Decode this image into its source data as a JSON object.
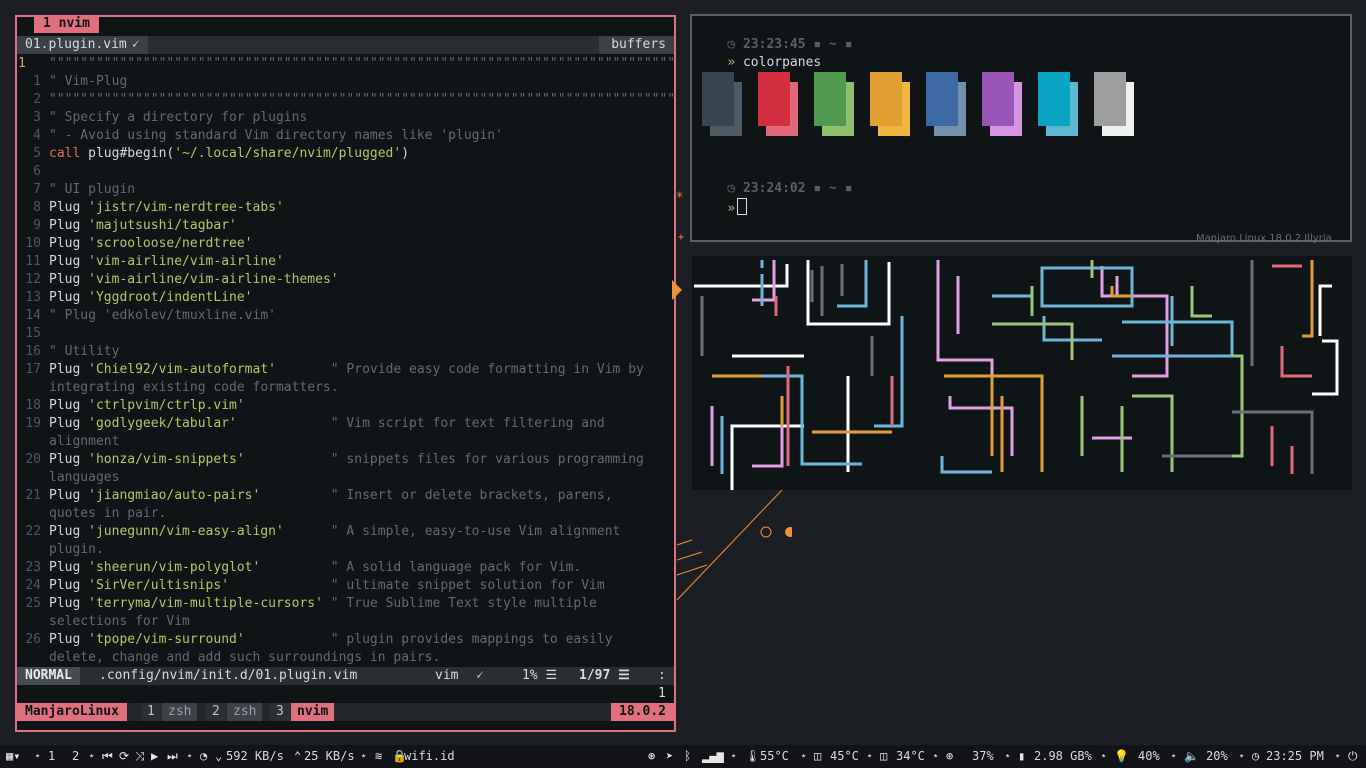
{
  "nvim": {
    "tab_title": "1 nvim",
    "file_tab": "01.plugin.vim",
    "file_icon": "🗸",
    "buffers_label": "buffers",
    "lines": [
      {
        "n": "1",
        "cur": true,
        "parts": [
          [
            "cmt",
            "\"\"\"\"\"\"\"\"\"\"\"\"\"\"\"\"\"\"\"\"\"\"\"\"\"\"\"\"\"\"\"\"\"\"\"\"\"\"\"\"\"\"\"\"\"\"\"\"\"\"\"\"\"\"\"\"\"\"\"\"\"\"\"\"\"\"\"\"\"\"\"\"\"\"\"\"\"\"\"\""
          ]
        ]
      },
      {
        "n": "1",
        "parts": [
          [
            "cmt",
            "\" Vim-Plug"
          ]
        ]
      },
      {
        "n": "2",
        "parts": [
          [
            "cmt",
            "\"\"\"\"\"\"\"\"\"\"\"\"\"\"\"\"\"\"\"\"\"\"\"\"\"\"\"\"\"\"\"\"\"\"\"\"\"\"\"\"\"\"\"\"\"\"\"\"\"\"\"\"\"\"\"\"\"\"\"\"\"\"\"\"\"\"\"\"\"\"\"\"\"\"\"\"\"\"\"\""
          ]
        ]
      },
      {
        "n": "3",
        "parts": [
          [
            "cmt",
            "\" Specify a directory for plugins"
          ]
        ]
      },
      {
        "n": "4",
        "parts": [
          [
            "cmt",
            "\" - Avoid using standard Vim directory names like 'plugin'"
          ]
        ]
      },
      {
        "n": "5",
        "parts": [
          [
            "kw",
            "call"
          ],
          [
            "plain",
            " plug#begin("
          ],
          [
            "str",
            "'~/.local/share/nvim/plugged'"
          ],
          [
            "plain",
            ")"
          ]
        ]
      },
      {
        "n": "6",
        "parts": []
      },
      {
        "n": "7",
        "parts": [
          [
            "cmt",
            "\" UI plugin"
          ]
        ]
      },
      {
        "n": "8",
        "parts": [
          [
            "plain",
            "Plug "
          ],
          [
            "str",
            "'jistr/vim-nerdtree-tabs'"
          ]
        ]
      },
      {
        "n": "9",
        "parts": [
          [
            "plain",
            "Plug "
          ],
          [
            "str",
            "'majutsushi/tagbar'"
          ]
        ]
      },
      {
        "n": "10",
        "parts": [
          [
            "plain",
            "Plug "
          ],
          [
            "str",
            "'scrooloose/nerdtree'"
          ]
        ]
      },
      {
        "n": "11",
        "parts": [
          [
            "plain",
            "Plug "
          ],
          [
            "str",
            "'vim-airline/vim-airline'"
          ]
        ]
      },
      {
        "n": "12",
        "parts": [
          [
            "plain",
            "Plug "
          ],
          [
            "str",
            "'vim-airline/vim-airline-themes'"
          ]
        ]
      },
      {
        "n": "13",
        "parts": [
          [
            "plain",
            "Plug "
          ],
          [
            "str",
            "'Yggdroot/indentLine'"
          ]
        ]
      },
      {
        "n": "14",
        "parts": [
          [
            "cmt",
            "\" Plug 'edkolev/tmuxline.vim'"
          ]
        ]
      },
      {
        "n": "15",
        "parts": []
      },
      {
        "n": "16",
        "parts": [
          [
            "cmt",
            "\" Utility"
          ]
        ]
      },
      {
        "n": "17",
        "parts": [
          [
            "plain",
            "Plug "
          ],
          [
            "str",
            "'Chiel92/vim-autoformat'"
          ],
          [
            "plain",
            "       "
          ],
          [
            "cmt",
            "\" Provide easy code formatting in Vim by"
          ]
        ]
      },
      {
        "n": "",
        "parts": [
          [
            "cmt",
            "integrating existing code formatters."
          ]
        ]
      },
      {
        "n": "18",
        "parts": [
          [
            "plain",
            "Plug "
          ],
          [
            "str",
            "'ctrlpvim/ctrlp.vim'"
          ]
        ]
      },
      {
        "n": "19",
        "parts": [
          [
            "plain",
            "Plug "
          ],
          [
            "str",
            "'godlygeek/tabular'"
          ],
          [
            "plain",
            "            "
          ],
          [
            "cmt",
            "\" Vim script for text filtering and"
          ]
        ]
      },
      {
        "n": "",
        "parts": [
          [
            "cmt",
            "alignment"
          ]
        ]
      },
      {
        "n": "20",
        "parts": [
          [
            "plain",
            "Plug "
          ],
          [
            "str",
            "'honza/vim-snippets'"
          ],
          [
            "plain",
            "           "
          ],
          [
            "cmt",
            "\" snippets files for various programming"
          ]
        ]
      },
      {
        "n": "",
        "parts": [
          [
            "cmt",
            "languages"
          ]
        ]
      },
      {
        "n": "21",
        "parts": [
          [
            "plain",
            "Plug "
          ],
          [
            "str",
            "'jiangmiao/auto-pairs'"
          ],
          [
            "plain",
            "         "
          ],
          [
            "cmt",
            "\" Insert or delete brackets, parens,"
          ]
        ]
      },
      {
        "n": "",
        "parts": [
          [
            "cmt",
            "quotes in pair."
          ]
        ]
      },
      {
        "n": "22",
        "parts": [
          [
            "plain",
            "Plug "
          ],
          [
            "str",
            "'junegunn/vim-easy-align'"
          ],
          [
            "plain",
            "      "
          ],
          [
            "cmt",
            "\" A simple, easy-to-use Vim alignment"
          ]
        ]
      },
      {
        "n": "",
        "parts": [
          [
            "cmt",
            "plugin."
          ]
        ]
      },
      {
        "n": "23",
        "parts": [
          [
            "plain",
            "Plug "
          ],
          [
            "str",
            "'sheerun/vim-polyglot'"
          ],
          [
            "plain",
            "         "
          ],
          [
            "cmt",
            "\" A solid language pack for Vim."
          ]
        ]
      },
      {
        "n": "24",
        "parts": [
          [
            "plain",
            "Plug "
          ],
          [
            "str",
            "'SirVer/ultisnips'"
          ],
          [
            "plain",
            "             "
          ],
          [
            "cmt",
            "\" ultimate snippet solution for Vim"
          ]
        ]
      },
      {
        "n": "25",
        "parts": [
          [
            "plain",
            "Plug "
          ],
          [
            "str",
            "'terryma/vim-multiple-cursors'"
          ],
          [
            "plain",
            " "
          ],
          [
            "cmt",
            "\" True Sublime Text style multiple"
          ]
        ]
      },
      {
        "n": "",
        "parts": [
          [
            "cmt",
            "selections for Vim"
          ]
        ]
      },
      {
        "n": "26",
        "parts": [
          [
            "plain",
            "Plug "
          ],
          [
            "str",
            "'tpope/vim-surround'"
          ],
          [
            "plain",
            "           "
          ],
          [
            "cmt",
            "\" plugin provides mappings to easily"
          ]
        ]
      },
      {
        "n": "",
        "parts": [
          [
            "cmt",
            "delete, change and add such surroundings in pairs."
          ]
        ]
      }
    ],
    "status": {
      "mode": "NORMAL",
      "path": ".config/nvim/init.d/01.plugin.vim",
      "filetype": "vim",
      "filetype_icon": "🗸",
      "percent": "1% ☰",
      "position": "1/97 ☰",
      "column": ":  1"
    }
  },
  "tmux": {
    "session": "ManjaroLinux",
    "windows": [
      {
        "index": "1",
        "name": "zsh",
        "active": false
      },
      {
        "index": "2",
        "name": "zsh",
        "active": false
      },
      {
        "index": "3",
        "name": "nvim",
        "active": true
      }
    ],
    "version": "18.0.2"
  },
  "terminal": {
    "prompt1": "23:23:45 ▪ ~ ▪",
    "command1": "colorpanes",
    "prompt2": "23:24:02 ▪ ~ ▪",
    "chevron": "»",
    "panes": [
      {
        "dark": "#37474f",
        "light": "#4f5b62"
      },
      {
        "dark": "#d32f3f",
        "light": "#e26a78"
      },
      {
        "dark": "#519a4f",
        "light": "#8fc06f"
      },
      {
        "dark": "#e2a033",
        "light": "#f2b540"
      },
      {
        "dark": "#3e6aa3",
        "light": "#7490ad"
      },
      {
        "dark": "#9b55b6",
        "light": "#d496e0"
      },
      {
        "dark": "#09a5c2",
        "light": "#5fb8d2"
      },
      {
        "dark": "#9e9e9e",
        "light": "#f0f0f0"
      }
    ]
  },
  "wm_hint": "Manjaro Linux 18.0.2 Illyria",
  "bar": {
    "ws1": "1",
    "ws2": "2",
    "down": "592 KB/s",
    "up": "25 KB/s",
    "wifi": "wifi.id",
    "temp1": "55°C",
    "temp2": "45°C",
    "temp3": "34°C",
    "cpu": "37%",
    "mem": "2.98 GB%",
    "bright": "40%",
    "vol": "20%",
    "clock": "23:25 PM"
  },
  "colors": {
    "accent": "#e0707e",
    "bg": "#0f1417",
    "orange": "#f0923b"
  }
}
